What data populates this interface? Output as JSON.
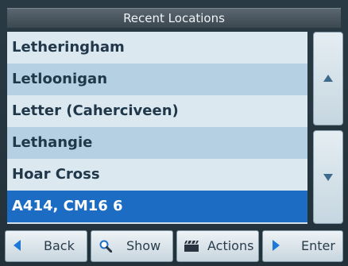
{
  "header": {
    "title": "Recent Locations"
  },
  "locations": [
    {
      "label": "Letheringham"
    },
    {
      "label": "Letloonigan"
    },
    {
      "label": "Letter (Caherciveen)"
    },
    {
      "label": "Lethangie"
    },
    {
      "label": "Hoar Cross"
    },
    {
      "label": "A414, CM16 6"
    }
  ],
  "selected_index": 5,
  "scroll": {
    "up_icon": "arrow-up-icon",
    "down_icon": "arrow-down-icon"
  },
  "toolbar": {
    "back_label": "Back",
    "show_label": "Show",
    "actions_label": "Actions",
    "enter_label": "Enter"
  },
  "colors": {
    "selected_row": "#1c6cc4",
    "row_alt": "#b4d0e2",
    "accent_icon": "#1f78d8"
  }
}
